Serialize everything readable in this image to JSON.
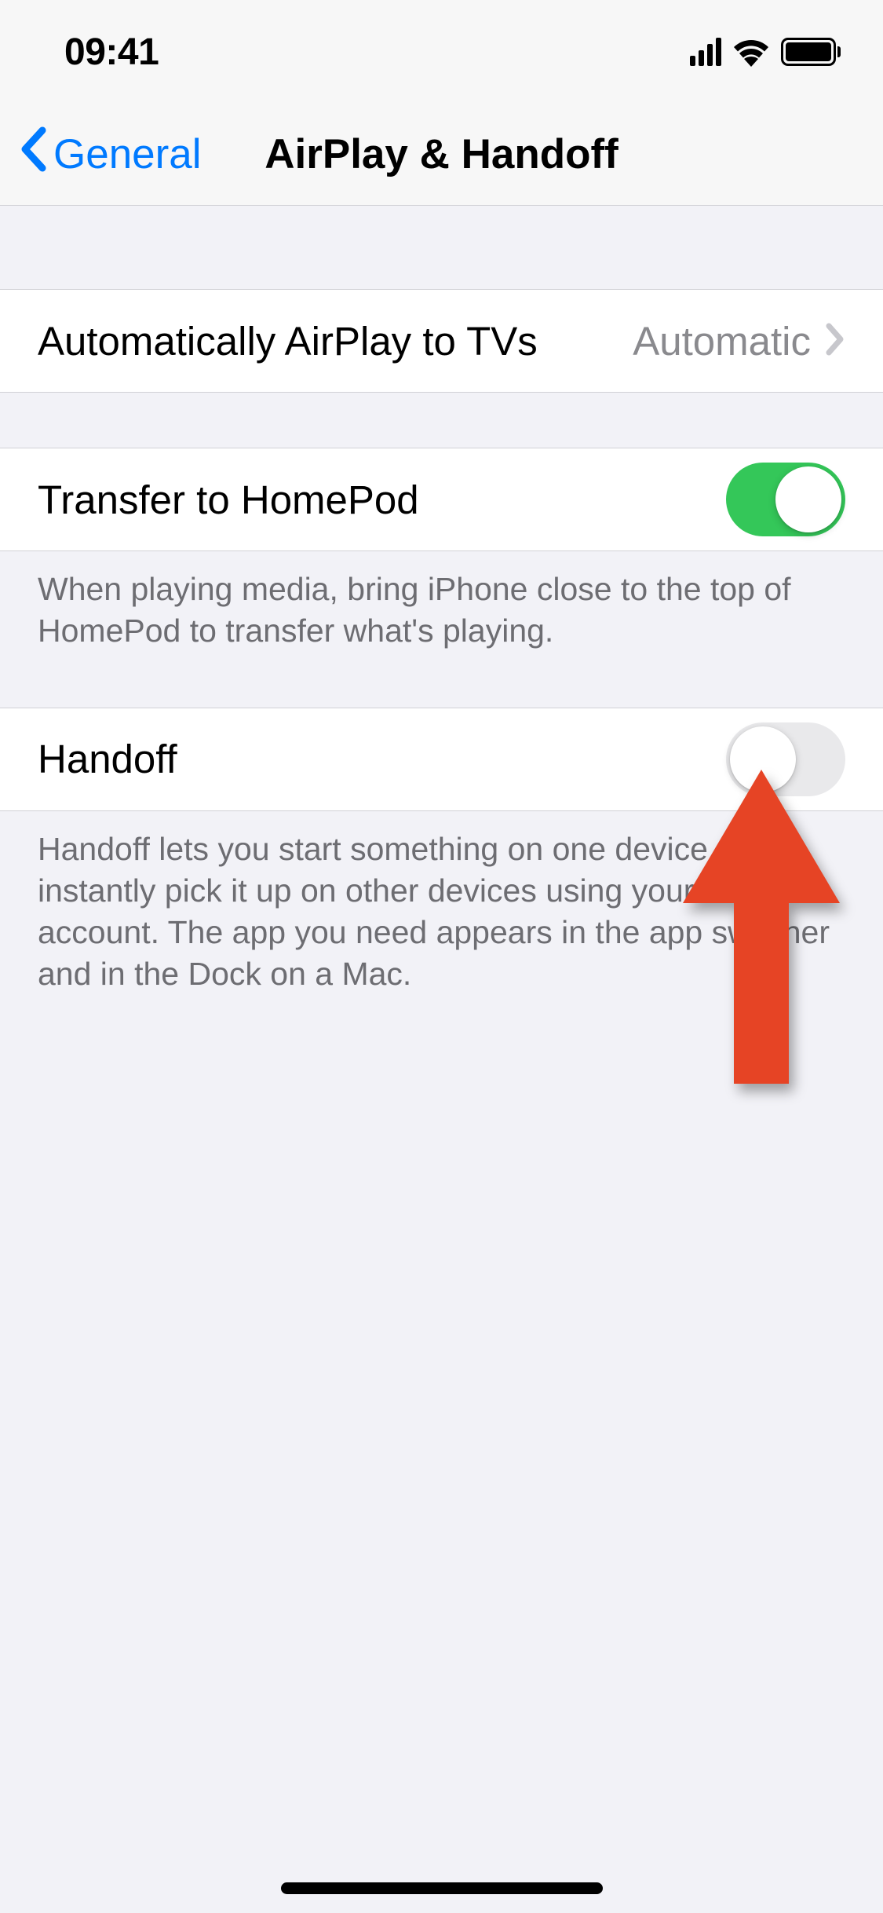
{
  "statusBar": {
    "time": "09:41"
  },
  "nav": {
    "backLabel": "General",
    "title": "AirPlay & Handoff"
  },
  "rows": {
    "airplay": {
      "label": "Automatically AirPlay to TVs",
      "value": "Automatic"
    },
    "transfer": {
      "label": "Transfer to HomePod",
      "footer": "When playing media, bring iPhone close to the top of HomePod to transfer what's playing."
    },
    "handoff": {
      "label": "Handoff",
      "footer": "Handoff lets you start something on one device and instantly pick it up on other devices using your iCloud account. The app you need appears in the app switcher and in the Dock on a Mac."
    }
  }
}
